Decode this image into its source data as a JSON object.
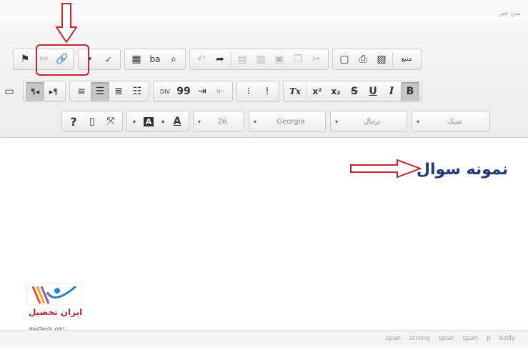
{
  "header": {
    "title": "متن خبر"
  },
  "toolbar": {
    "row1": {
      "group_links": [
        "flag-icon",
        "unlink-icon",
        "link-icon"
      ],
      "group_spell": [
        "spellcheck-dropdown-icon",
        "spellcheck-icon"
      ],
      "group_find": [
        "select-all-icon",
        "replace-icon",
        "find-icon"
      ],
      "group_clipboard": [
        "undo-icon",
        "redo-icon",
        "paste-word-icon",
        "paste-text-icon",
        "paste-icon",
        "copy-icon",
        "cut-icon"
      ],
      "group_doc": [
        "preview-icon",
        "print-icon",
        "templates-icon"
      ],
      "source_label": "منبع"
    },
    "row2": {
      "group_dir": [
        "rtl-icon",
        "ltr-icon"
      ],
      "group_align": [
        "justify-icon",
        "align-right-icon",
        "align-center-icon",
        "align-left-icon"
      ],
      "group_block": [
        "div-icon",
        "blockquote-icon",
        "indent-icon",
        "outdent-icon"
      ],
      "group_list": [
        "bulleted-list-icon",
        "numbered-list-icon"
      ],
      "group_format": [
        "remove-format-icon",
        "superscript-icon",
        "subscript-icon",
        "strike-icon",
        "underline-icon",
        "italic-icon",
        "bold-icon"
      ],
      "labels": {
        "superscript": "x²",
        "subscript": "x₂",
        "strike": "S",
        "underline": "U",
        "italic": "I",
        "bold": "B",
        "remove_format": "Tx",
        "div": "DIV",
        "quote": "99"
      }
    },
    "row3": {
      "group_help": [
        "help-icon",
        "show-blocks-icon",
        "maximize-icon"
      ],
      "bg_color_label": "A",
      "text_color_label": "A",
      "size_value": "26",
      "font_value": "Georgia",
      "format_value": "نرمال",
      "style_value": "سبک",
      "help_label": "?"
    }
  },
  "content": {
    "sample_text": "نمونه سوال"
  },
  "logo": {
    "text": "ایران تحصیل",
    "sub": "IRANTAHSIL.ORG"
  },
  "statusbar": {
    "path": [
      "span",
      "strong",
      "span",
      "span",
      "p",
      "body"
    ]
  },
  "colors": {
    "highlight": "#c0262d",
    "sample_text": "#1e3a7a",
    "toolbar_bg": "#ececec"
  }
}
